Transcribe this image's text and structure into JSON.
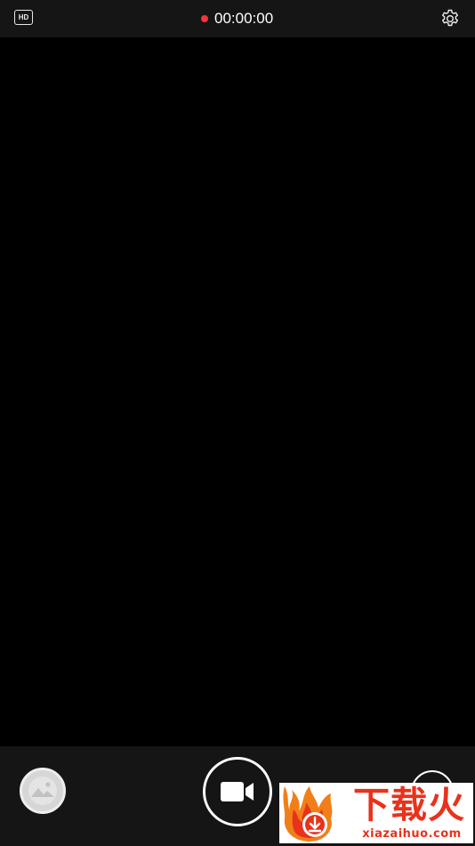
{
  "topbar": {
    "quality_label": "HD",
    "recording_time": "00:00:00",
    "recording_indicator_color": "#f2363b",
    "settings_icon": "gear-icon"
  },
  "bottombar": {
    "gallery_icon": "image-icon",
    "record_icon": "video-camera-icon",
    "switch_icon": "camera-switch-icon"
  },
  "watermark": {
    "title": "下载火",
    "domain": "xiazaihuo.com",
    "brand_color": "#e8321c"
  }
}
